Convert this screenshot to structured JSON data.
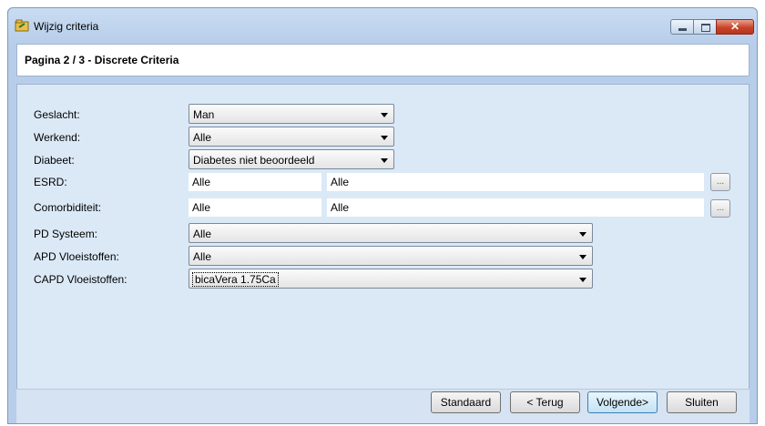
{
  "window": {
    "title": "Wijzig criteria"
  },
  "header": {
    "page_title": "Pagina 2 / 3 - Discrete Criteria"
  },
  "form": {
    "geslacht": {
      "label": "Geslacht:",
      "value": "Man"
    },
    "werkend": {
      "label": "Werkend:",
      "value": "Alle"
    },
    "diabeet": {
      "label": "Diabeet:",
      "value": "Diabetes niet beoordeeld"
    },
    "esrd": {
      "label": "ESRD:",
      "value1": "Alle",
      "value2": "Alle",
      "button": "..."
    },
    "comorbiditeit": {
      "label": "Comorbiditeit:",
      "value1": "Alle",
      "value2": "Alle",
      "button": "..."
    },
    "pd_systeem": {
      "label": "PD Systeem:",
      "value": "Alle"
    },
    "apd_vloeistoffen": {
      "label": "APD Vloeistoffen:",
      "value": "Alle"
    },
    "capd_vloeistoffen": {
      "label": "CAPD Vloeistoffen:",
      "value": "bicaVera 1.75Ca"
    }
  },
  "buttons": {
    "standaard": "Standaard",
    "terug": "< Terug",
    "volgende": "Volgende>",
    "sluiten": "Sluiten"
  },
  "colors": {
    "accent": "#3c7fb1",
    "close": "#c8452b",
    "background": "#dbe9f7"
  }
}
